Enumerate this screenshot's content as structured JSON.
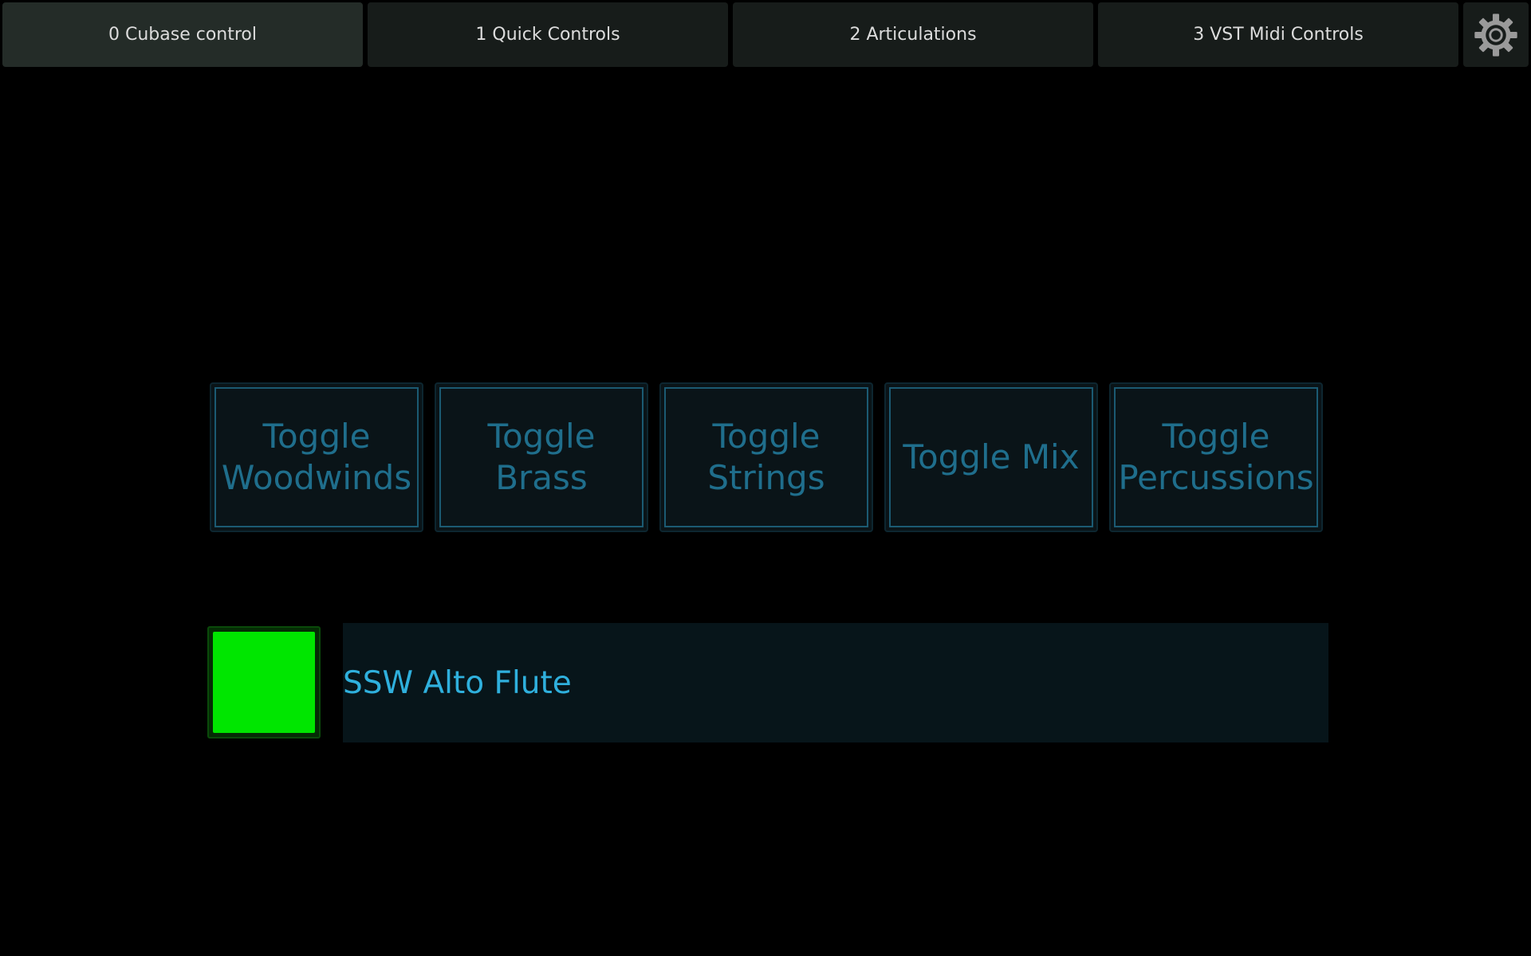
{
  "tabs": [
    {
      "label": "0 Cubase control",
      "active": true
    },
    {
      "label": "1 Quick Controls",
      "active": false
    },
    {
      "label": "2 Articulations",
      "active": false
    },
    {
      "label": "3 VST Midi Controls",
      "active": false
    }
  ],
  "settings_icon": "gear-icon",
  "toggles": [
    {
      "label": "Toggle\nWoodwinds"
    },
    {
      "label": "Toggle\nBrass"
    },
    {
      "label": "Toggle\nStrings"
    },
    {
      "label": "Toggle Mix"
    },
    {
      "label": "Toggle\nPercussions"
    }
  ],
  "track": {
    "name": "SSW Alto Flute",
    "indicator_color": "#00e600"
  },
  "colors": {
    "background": "#000000",
    "tab_bg": "#171c1a",
    "tab_active_bg": "#242c28",
    "toggle_text": "#1f6e8c",
    "toggle_border": "#1b5a72",
    "track_text": "#2fb0dd"
  }
}
